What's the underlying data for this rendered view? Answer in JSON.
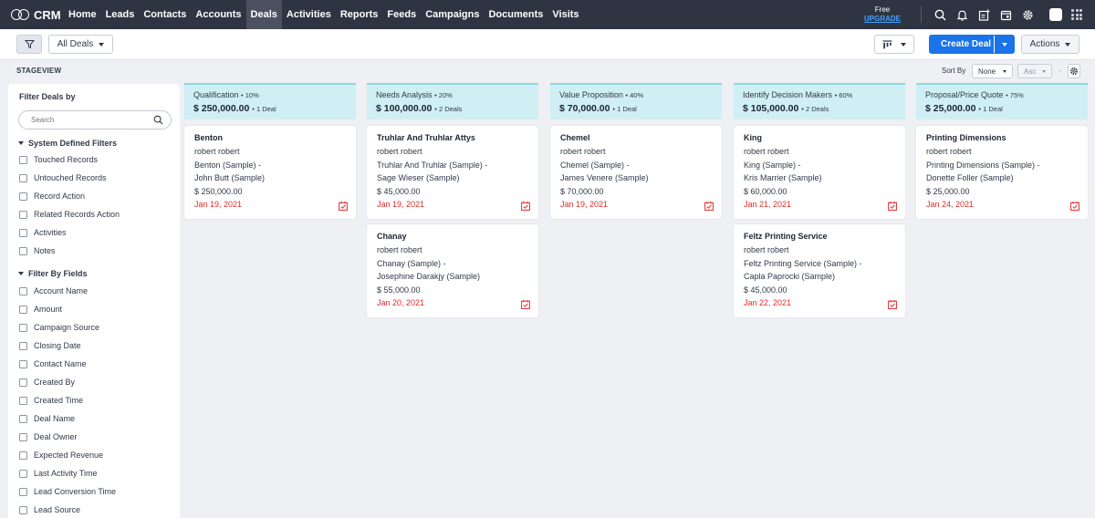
{
  "app": {
    "name": "CRM"
  },
  "nav": {
    "links": [
      "Home",
      "Leads",
      "Contacts",
      "Accounts",
      "Deals",
      "Activities",
      "Reports",
      "Feeds",
      "Campaigns",
      "Documents",
      "Visits"
    ],
    "active": "Deals",
    "plan_label": "Free",
    "upgrade_label": "UPGRADE",
    "icons": [
      "search-icon",
      "bell-icon",
      "add-note-icon",
      "calendar-icon",
      "settings-icon",
      "avatar",
      "apps-grid-icon"
    ]
  },
  "toolbar": {
    "view_label": "All Deals",
    "create_label": "Create Deal",
    "actions_label": "Actions"
  },
  "stageview": {
    "label": "STAGEVIEW",
    "sort_by_label": "Sort By",
    "sort_field": "None",
    "sort_order": "Asc",
    "separator": "-"
  },
  "sidebar": {
    "title": "Filter Deals by",
    "search_placeholder": "Search",
    "system_section": "System Defined Filters",
    "system_items": [
      "Touched Records",
      "Untouched Records",
      "Record Action",
      "Related Records Action",
      "Activities",
      "Notes"
    ],
    "fields_section": "Filter By Fields",
    "field_items": [
      "Account Name",
      "Amount",
      "Campaign Source",
      "Closing Date",
      "Contact Name",
      "Created By",
      "Created Time",
      "Deal Name",
      "Deal Owner",
      "Expected Revenue",
      "Last Activity Time",
      "Lead Conversion Time",
      "Lead Source"
    ]
  },
  "stages": [
    {
      "name": "Qualification",
      "pct": "• 10%",
      "amount": "$ 250,000.00",
      "count": "• 1 Deal",
      "deals": [
        {
          "title": "Benton",
          "owner": "robert robert",
          "account": "Benton (Sample)  -",
          "contact": "John Butt (Sample)",
          "amount": "$ 250,000.00",
          "date": "Jan 19, 2021"
        }
      ]
    },
    {
      "name": "Needs Analysis",
      "pct": "• 20%",
      "amount": "$ 100,000.00",
      "count": "• 2 Deals",
      "deals": [
        {
          "title": "Truhlar And Truhlar Attys",
          "owner": "robert robert",
          "account": "Truhlar And Truhlar (Sample)  -",
          "contact": "Sage Wieser (Sample)",
          "amount": "$ 45,000.00",
          "date": "Jan 19, 2021"
        },
        {
          "title": "Chanay",
          "owner": "robert robert",
          "account": "Chanay (Sample)  -",
          "contact": "Josephine Darakjy (Sample)",
          "amount": "$ 55,000.00",
          "date": "Jan 20, 2021"
        }
      ]
    },
    {
      "name": "Value Proposition",
      "pct": "• 40%",
      "amount": "$ 70,000.00",
      "count": "• 1 Deal",
      "deals": [
        {
          "title": "Chemel",
          "owner": "robert robert",
          "account": "Chemel (Sample)  -",
          "contact": "James Venere (Sample)",
          "amount": "$ 70,000.00",
          "date": "Jan 19, 2021"
        }
      ]
    },
    {
      "name": "Identify Decision Makers",
      "pct": "• 60%",
      "amount": "$ 105,000.00",
      "count": "• 2 Deals",
      "deals": [
        {
          "title": "King",
          "owner": "robert robert",
          "account": "King (Sample)  -",
          "contact": "Kris Marrier (Sample)",
          "amount": "$ 60,000.00",
          "date": "Jan 21, 2021"
        },
        {
          "title": "Feltz Printing Service",
          "owner": "robert robert",
          "account": "Feltz Printing Service (Sample)  -",
          "contact": "Capla Paprocki (Sample)",
          "amount": "$ 45,000.00",
          "date": "Jan 22, 2021"
        }
      ]
    },
    {
      "name": "Proposal/Price Quote",
      "pct": "• 75%",
      "amount": "$ 25,000.00",
      "count": "• 1 Deal",
      "deals": [
        {
          "title": "Printing Dimensions",
          "owner": "robert robert",
          "account": "Printing Dimensions (Sample)  -",
          "contact": "Donette Foller (Sample)",
          "amount": "$ 25,000.00",
          "date": "Jan 24, 2021"
        }
      ]
    }
  ],
  "colors": {
    "nav_bg": "#2e3442",
    "primary": "#1a73e8",
    "stage_head": "#cfeff4",
    "date_red": "#e02b2b"
  }
}
